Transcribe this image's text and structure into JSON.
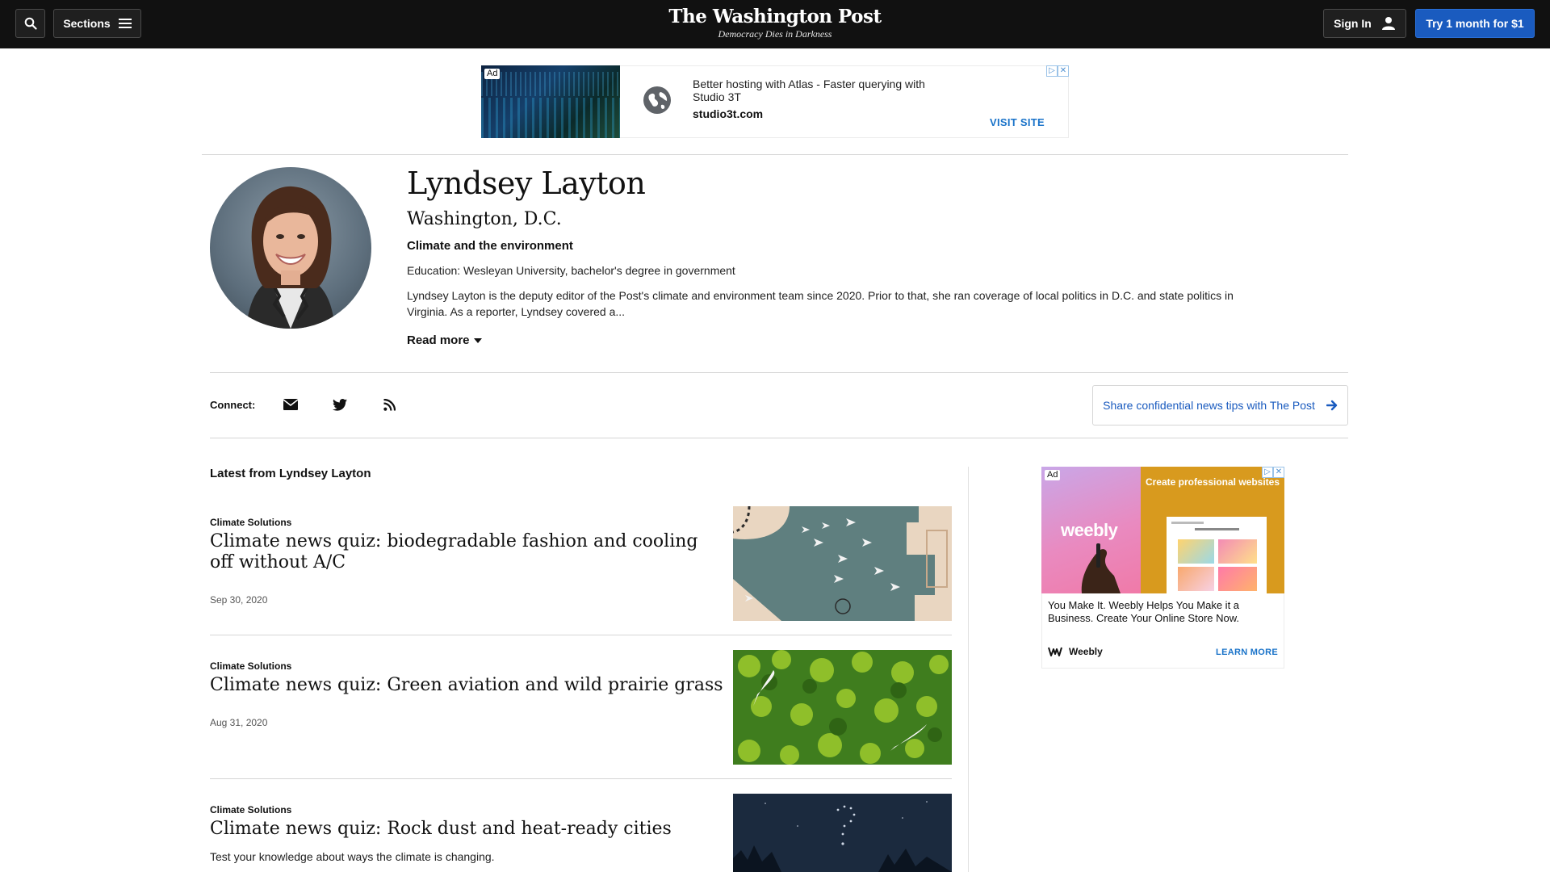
{
  "header": {
    "search_icon": "search-icon",
    "sections_label": "Sections",
    "logo_title": "The Washington Post",
    "logo_tagline": "Democracy Dies in Darkness",
    "signin_label": "Sign In",
    "try_label": "Try 1 month for $1"
  },
  "top_ad": {
    "badge": "Ad",
    "headline": "Better hosting with Atlas - Faster querying with Studio 3T",
    "url": "studio3t.com",
    "cta": "VISIT SITE"
  },
  "author": {
    "name": "Lyndsey Layton",
    "location": "Washington, D.C.",
    "beat": "Climate and the environment",
    "education": "Education: Wesleyan University, bachelor's degree in government",
    "bio": "Lyndsey Layton is the deputy editor of the Post's climate and environment team since 2020. Prior to that, she ran coverage of local politics in D.C. and state politics in Virginia. As a reporter, Lyndsey covered a...",
    "read_more": "Read more"
  },
  "connect": {
    "label": "Connect:",
    "icons": [
      "email-icon",
      "twitter-icon",
      "rss-icon"
    ],
    "tips": "Share confidential news tips with The Post"
  },
  "latest": {
    "title": "Latest from Lyndsey Layton",
    "articles": [
      {
        "kicker": "Climate Solutions",
        "title": "Climate news quiz: biodegradable fashion and cooling off without A/C",
        "date": "Sep 30, 2020"
      },
      {
        "kicker": "Climate Solutions",
        "title": "Climate news quiz: Green aviation and wild prairie grass",
        "date": "Aug 31, 2020"
      },
      {
        "kicker": "Climate Solutions",
        "title": "Climate news quiz: Rock dust and heat-ready cities",
        "description": "Test your knowledge about ways the climate is changing."
      }
    ]
  },
  "side_ad": {
    "badge": "Ad",
    "brand_word": "weebly",
    "headline": "Create professional websites",
    "copy": "You Make It. Weebly Helps You Make it a Business. Create Your Online Store Now.",
    "brand": "Weebly",
    "cta": "LEARN MORE"
  },
  "colors": {
    "topbar": "#111111",
    "accent_blue": "#1a5bbf",
    "link_blue": "#1a73c9"
  }
}
